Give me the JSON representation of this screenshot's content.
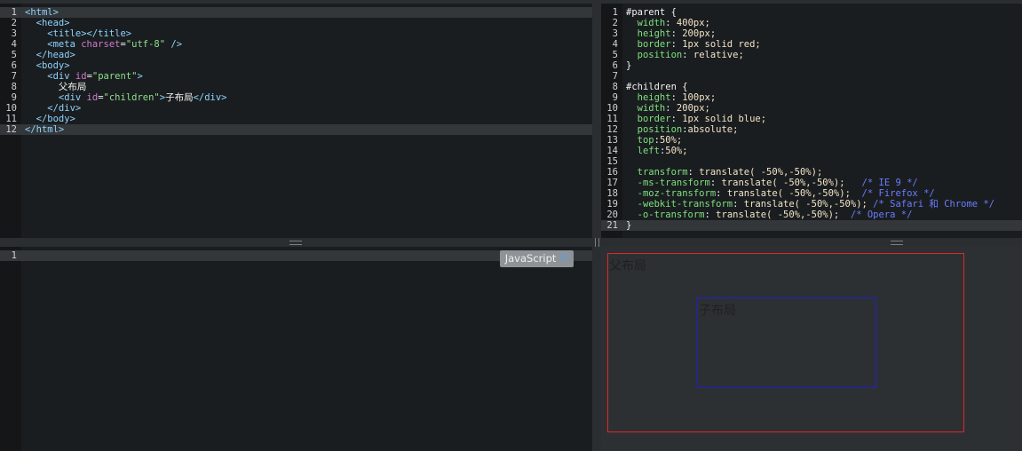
{
  "html_editor": {
    "lines": [
      {
        "n": "1",
        "tokens": [
          [
            "tag",
            "<html>"
          ]
        ]
      },
      {
        "n": "2",
        "tokens": [
          [
            "tag",
            "  <head>"
          ]
        ]
      },
      {
        "n": "3",
        "tokens": [
          [
            "tag",
            "    <title></title>"
          ]
        ]
      },
      {
        "n": "4",
        "tokens": [
          [
            "tag",
            "    <meta "
          ],
          [
            "attr",
            "charset"
          ],
          [
            "txt",
            "="
          ],
          [
            "str",
            "\"utf-8\""
          ],
          [
            "tag",
            " />"
          ]
        ]
      },
      {
        "n": "5",
        "tokens": [
          [
            "tag",
            "  </head>"
          ]
        ]
      },
      {
        "n": "6",
        "tokens": [
          [
            "tag",
            "  <body>"
          ]
        ]
      },
      {
        "n": "7",
        "tokens": [
          [
            "tag",
            "    <div "
          ],
          [
            "attr",
            "id"
          ],
          [
            "txt",
            "="
          ],
          [
            "str",
            "\"parent\""
          ],
          [
            "tag",
            ">"
          ]
        ]
      },
      {
        "n": "8",
        "tokens": [
          [
            "txt",
            "      父布局"
          ]
        ]
      },
      {
        "n": "9",
        "tokens": [
          [
            "tag",
            "      <div "
          ],
          [
            "attr",
            "id"
          ],
          [
            "txt",
            "="
          ],
          [
            "str",
            "\"children\""
          ],
          [
            "tag",
            ">"
          ],
          [
            "txt",
            "子布局"
          ],
          [
            "tag",
            "</div>"
          ]
        ]
      },
      {
        "n": "10",
        "tokens": [
          [
            "tag",
            "    </div>"
          ]
        ]
      },
      {
        "n": "11",
        "tokens": [
          [
            "tag",
            "  </body>"
          ]
        ]
      },
      {
        "n": "12",
        "tokens": [
          [
            "tag",
            "</html>"
          ]
        ]
      }
    ],
    "active_lines": [
      "1",
      "12"
    ]
  },
  "css_editor": {
    "lines": [
      {
        "n": "1",
        "tokens": [
          [
            "sel",
            "#parent {"
          ]
        ]
      },
      {
        "n": "2",
        "tokens": [
          [
            "prop",
            "  width"
          ],
          [
            "txt",
            ": "
          ],
          [
            "val",
            "400px;"
          ]
        ]
      },
      {
        "n": "3",
        "tokens": [
          [
            "prop",
            "  height"
          ],
          [
            "txt",
            ": "
          ],
          [
            "val",
            "200px;"
          ]
        ]
      },
      {
        "n": "4",
        "tokens": [
          [
            "prop",
            "  border"
          ],
          [
            "txt",
            ": "
          ],
          [
            "val",
            "1px solid red;"
          ]
        ]
      },
      {
        "n": "5",
        "tokens": [
          [
            "prop",
            "  position"
          ],
          [
            "txt",
            ": "
          ],
          [
            "val",
            "relative;"
          ]
        ]
      },
      {
        "n": "6",
        "tokens": [
          [
            "sel",
            "}"
          ]
        ]
      },
      {
        "n": "7",
        "tokens": []
      },
      {
        "n": "8",
        "tokens": [
          [
            "sel",
            "#children {"
          ]
        ]
      },
      {
        "n": "9",
        "tokens": [
          [
            "prop",
            "  height"
          ],
          [
            "txt",
            ": "
          ],
          [
            "val",
            "100px;"
          ]
        ]
      },
      {
        "n": "10",
        "tokens": [
          [
            "prop",
            "  width"
          ],
          [
            "txt",
            ": "
          ],
          [
            "val",
            "200px;"
          ]
        ]
      },
      {
        "n": "11",
        "tokens": [
          [
            "prop",
            "  border"
          ],
          [
            "txt",
            ": "
          ],
          [
            "val",
            "1px solid blue;"
          ]
        ]
      },
      {
        "n": "12",
        "tokens": [
          [
            "prop",
            "  position"
          ],
          [
            "txt",
            ":"
          ],
          [
            "val",
            "absolute;"
          ]
        ]
      },
      {
        "n": "13",
        "tokens": [
          [
            "prop",
            "  top"
          ],
          [
            "txt",
            ":"
          ],
          [
            "val",
            "50%;"
          ]
        ]
      },
      {
        "n": "14",
        "tokens": [
          [
            "prop",
            "  left"
          ],
          [
            "txt",
            ":"
          ],
          [
            "val",
            "50%;"
          ]
        ]
      },
      {
        "n": "15",
        "tokens": []
      },
      {
        "n": "16",
        "tokens": [
          [
            "prop",
            "  transform"
          ],
          [
            "txt",
            ": "
          ],
          [
            "val",
            "translate( -50%,-50%);"
          ]
        ]
      },
      {
        "n": "17",
        "tokens": [
          [
            "prop",
            "  -ms-transform"
          ],
          [
            "txt",
            ": "
          ],
          [
            "val",
            "translate( -50%,-50%);"
          ],
          [
            "cmt",
            "   /* IE 9 */"
          ]
        ]
      },
      {
        "n": "18",
        "tokens": [
          [
            "prop",
            "  -moz-transform"
          ],
          [
            "txt",
            ": "
          ],
          [
            "val",
            "translate( -50%,-50%);"
          ],
          [
            "cmt",
            "  /* Firefox */"
          ]
        ]
      },
      {
        "n": "19",
        "tokens": [
          [
            "prop",
            "  -webkit-transform"
          ],
          [
            "txt",
            ": "
          ],
          [
            "val",
            "translate( -50%,-50%);"
          ],
          [
            "cmt",
            " /* Safari 和 Chrome */"
          ]
        ]
      },
      {
        "n": "20",
        "tokens": [
          [
            "prop",
            "  -o-transform"
          ],
          [
            "txt",
            ": "
          ],
          [
            "val",
            "translate( -50%,-50%);"
          ],
          [
            "cmt",
            "  /* Opera */"
          ]
        ]
      },
      {
        "n": "21",
        "tokens": [
          [
            "sel",
            "}"
          ]
        ]
      }
    ],
    "active_lines": [
      "21"
    ]
  },
  "js_editor": {
    "lines": [
      {
        "n": "1",
        "tokens": []
      }
    ],
    "active_lines": [
      "1"
    ],
    "language_label": "JavaScript",
    "expand_icon": "expand-arrows-icon"
  },
  "preview": {
    "parent_text": "父布局",
    "children_text": "子布局",
    "parent_border_color": "#e0262b",
    "children_border_color": "#2020c8"
  }
}
